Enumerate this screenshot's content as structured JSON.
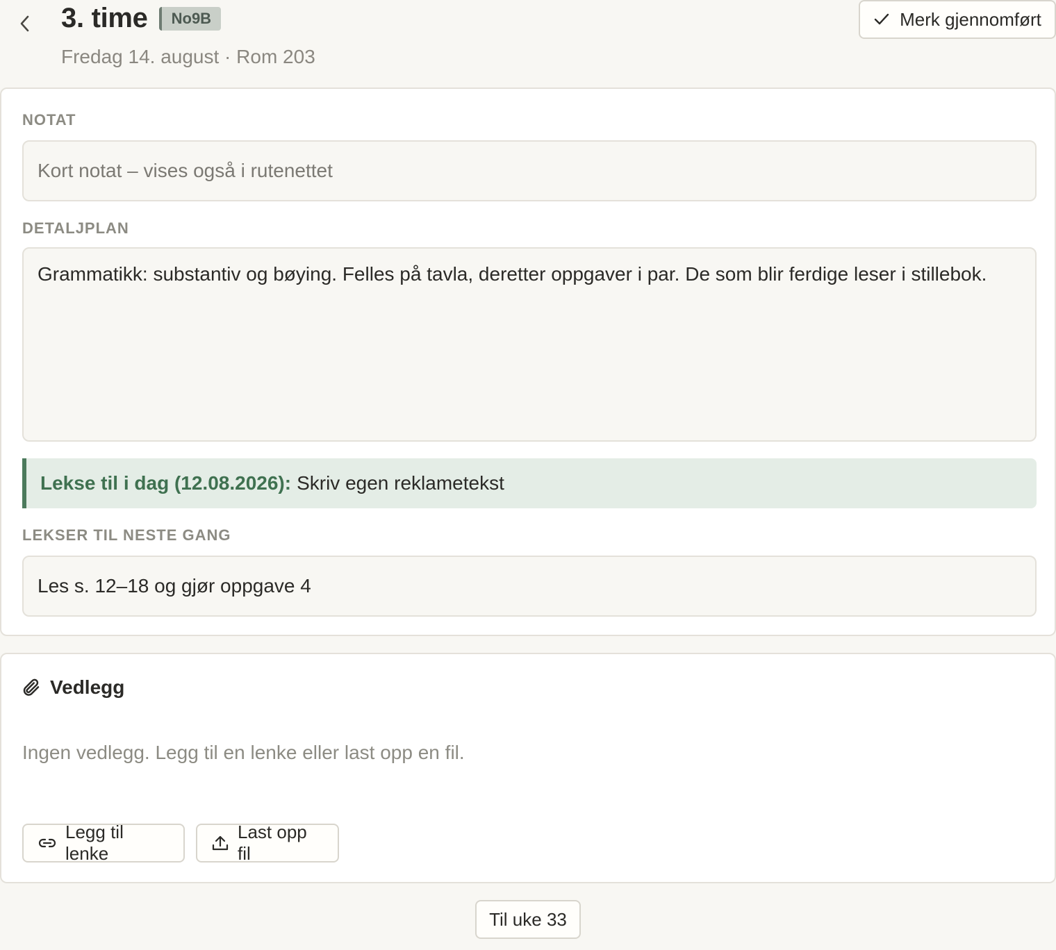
{
  "header": {
    "title": "3. time",
    "class_badge": "No9B",
    "subtitle": "Fredag 14. august · Rom 203",
    "back_icon": "chevron-left-icon",
    "done_button": {
      "label": "Merk gjennomført",
      "icon": "check-icon"
    }
  },
  "lesson": {
    "note": {
      "label": "NOTAT",
      "value": "",
      "placeholder": "Kort notat – vises også i rutenettet"
    },
    "plan": {
      "label": "DETALJPLAN",
      "value": "Grammatikk: substantiv og bøying. Felles på tavla, deretter oppgaver i par. De som blir ferdige leser i stillebok."
    },
    "homework_due": {
      "label": "Lekse til i dag (12.08.2026):",
      "text": "Skriv egen reklametekst"
    },
    "next_homework": {
      "label": "LEKSER TIL NESTE GANG",
      "value": "Les s. 12–18 og gjør oppgave 4"
    }
  },
  "attachments": {
    "title": "Vedlegg",
    "icon": "paperclip-icon",
    "empty_text": "Ingen vedlegg. Legg til en lenke eller last opp en fil.",
    "add_link_label": "Legg til lenke",
    "upload_label": "Last opp fil"
  },
  "footer": {
    "week_button": "Til uke 33"
  },
  "colors": {
    "background": "#f8f7f3",
    "accent_green": "#4c7a5c",
    "badge_bg": "#c9cfc8"
  }
}
